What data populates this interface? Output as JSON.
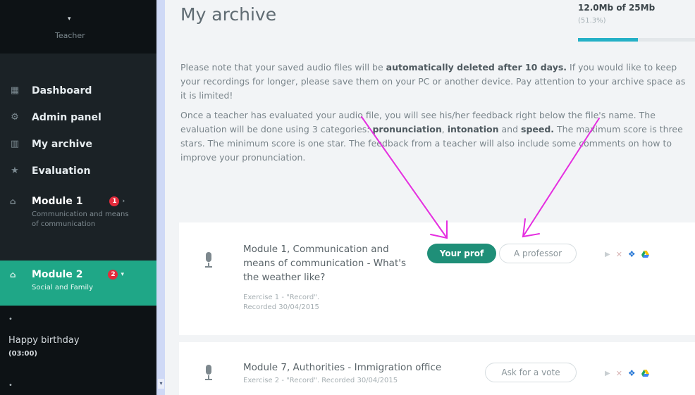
{
  "sidebar": {
    "profile": {
      "caret": "▾",
      "role": "Teacher"
    },
    "items": [
      {
        "label": "Dashboard",
        "icon": "grid-icon",
        "glyph": "▦"
      },
      {
        "label": "Admin panel",
        "icon": "gear-icon",
        "glyph": "⚙"
      },
      {
        "label": "My archive",
        "icon": "book-icon",
        "glyph": "▥"
      },
      {
        "label": "Evaluation",
        "icon": "star-icon",
        "glyph": "★"
      }
    ],
    "module1": {
      "title": "Module 1",
      "subtitle": "Communication and means of communication",
      "badge": "1",
      "icon_glyph": "⌂",
      "chev": "›"
    },
    "module2": {
      "title": "Module 2",
      "subtitle": "Social and Family",
      "badge": "2",
      "icon_glyph": "⌂",
      "chev": "▾"
    },
    "lesson": {
      "dot": "•",
      "title": "Happy birthday",
      "time": "(03:00)",
      "dot2": "•"
    }
  },
  "main": {
    "title": "My archive",
    "quota": {
      "used": "12.0Mb of 25Mb",
      "percent_text": "(51.3%)",
      "percent": 51.3
    },
    "intro": {
      "p1_a": "Please note that your saved audio files will be ",
      "p1_b": "automatically deleted after 10 days.",
      "p1_c": " If you would like to keep your recordings for longer, please save them on your PC or another device. Pay attention to your archive space as it is limited!",
      "p2_a": "Once a teacher has evaluated your audio file, you will see his/her feedback right below the file's name.",
      "p2_b": " The evaluation will be done using 3 categories: ",
      "p2_c": "pronunciation",
      "p2_d": ", ",
      "p2_e": "intonation",
      "p2_f": " and ",
      "p2_g": "speed.",
      "p2_h": " The maximum score is three stars. The minimum score is one star. The feedback from a teacher will also include some comments on how to improve your pronunciation."
    },
    "recordings": [
      {
        "title": "Module 1, Communication and means of communication - What's the weather like?",
        "meta": "Exercise 1 - \"Record\". Recorded 30/04/2015",
        "primary_button": "Your prof",
        "secondary_button": "A professor"
      },
      {
        "title": "Module 7, Authorities - Immigration office",
        "meta": "Exercise 2 - \"Record\". Recorded 30/04/2015",
        "secondary_button": "Ask for a vote"
      }
    ],
    "actions": {
      "play": "▶",
      "delete": "✕",
      "dropbox": "❖"
    }
  },
  "colors": {
    "accent": "#1fa787",
    "annotation": "#e52ee0",
    "sidebar": "#1b2226"
  }
}
